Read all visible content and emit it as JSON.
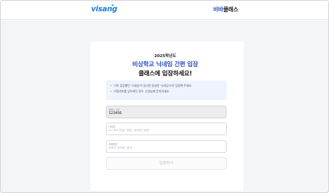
{
  "header": {
    "brand_logo": "visang",
    "service_logo_part1": "비바",
    "service_logo_part2": "클래스",
    "colors": {
      "brand": "#1e7fd8",
      "accent": "#2b57c5"
    }
  },
  "main": {
    "year": "2025학년도",
    "title_line1": "비상학교 닉네임 간편 입장",
    "title_line2": "클래스에 입장하세요!",
    "notices": [
      "이미 입장했던 '닉네임'이 있다면 동일한 '닉네임'으로 입장해 주세요.",
      "비밀번호를 잊어버린 경우, 선생님께 문의하세요."
    ],
    "class_code": {
      "label": "클래스 코드",
      "value": "123456"
    },
    "nickname": {
      "label": "닉네임",
      "placeholder": "2~5자 한글, 영문, 숫자만 입력"
    },
    "password": {
      "label": "비밀번호",
      "placeholder": "4자리 숫자만 입력"
    },
    "submit_label": "입장하기"
  }
}
